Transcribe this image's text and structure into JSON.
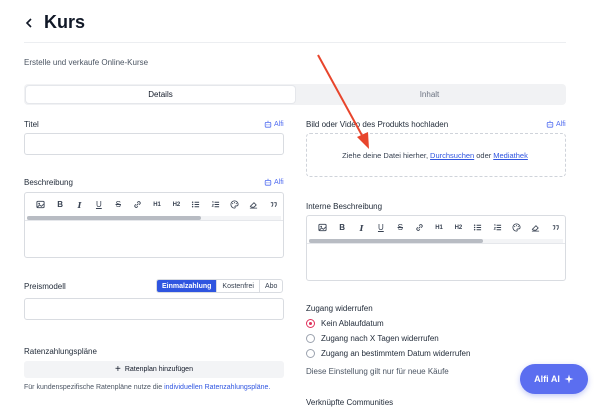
{
  "header": {
    "title": "Kurs",
    "subtitle": "Erstelle und verkaufe Online-Kurse"
  },
  "tabs": [
    {
      "label": "Details",
      "active": true
    },
    {
      "label": "Inhalt",
      "active": false
    }
  ],
  "ai_label": "Alfi",
  "left": {
    "title_label": "Titel",
    "description_label": "Beschreibung",
    "price_model": {
      "label": "Preismodell",
      "options": [
        {
          "label": "Einmalzahlung",
          "active": true
        },
        {
          "label": "Kostenfrei",
          "active": false
        },
        {
          "label": "Abo",
          "active": false
        }
      ]
    },
    "installments": {
      "label": "Ratenzahlungspläne",
      "add_button": "Ratenplan hinzufügen",
      "hint_prefix": "Für kundenspezifische Ratenpläne nutze die",
      "hint_link": "individuellen Ratenzahlungspläne."
    }
  },
  "right": {
    "upload_label": "Bild oder Video des Produkts hochladen",
    "dropzone": {
      "prefix": "Ziehe deine Datei hierher,",
      "browse": "Durchsuchen",
      "or": "oder",
      "library": "Mediathek"
    },
    "internal_description_label": "Interne Beschreibung",
    "access": {
      "label": "Zugang widerrufen",
      "options": [
        {
          "label": "Kein Ablaufdatum",
          "checked": true
        },
        {
          "label": "Zugang nach X Tagen widerrufen",
          "checked": false
        },
        {
          "label": "Zugang an bestimmtem Datum widerrufen",
          "checked": false
        }
      ],
      "note": "Diese Einstellung gilt nur für neue Käufe"
    },
    "communities_label": "Verknüpfte Communities"
  },
  "toolbar": {
    "bold": "B",
    "italic": "I",
    "underline": "U",
    "strike": "S",
    "h1": "H1",
    "h2": "H2"
  },
  "alfi_button": {
    "label": "Alfi AI"
  },
  "colors": {
    "accent": "#2f55e0",
    "radio": "#e0315b",
    "ai_button": "#5b6ef0",
    "arrow": "#e8452c"
  }
}
